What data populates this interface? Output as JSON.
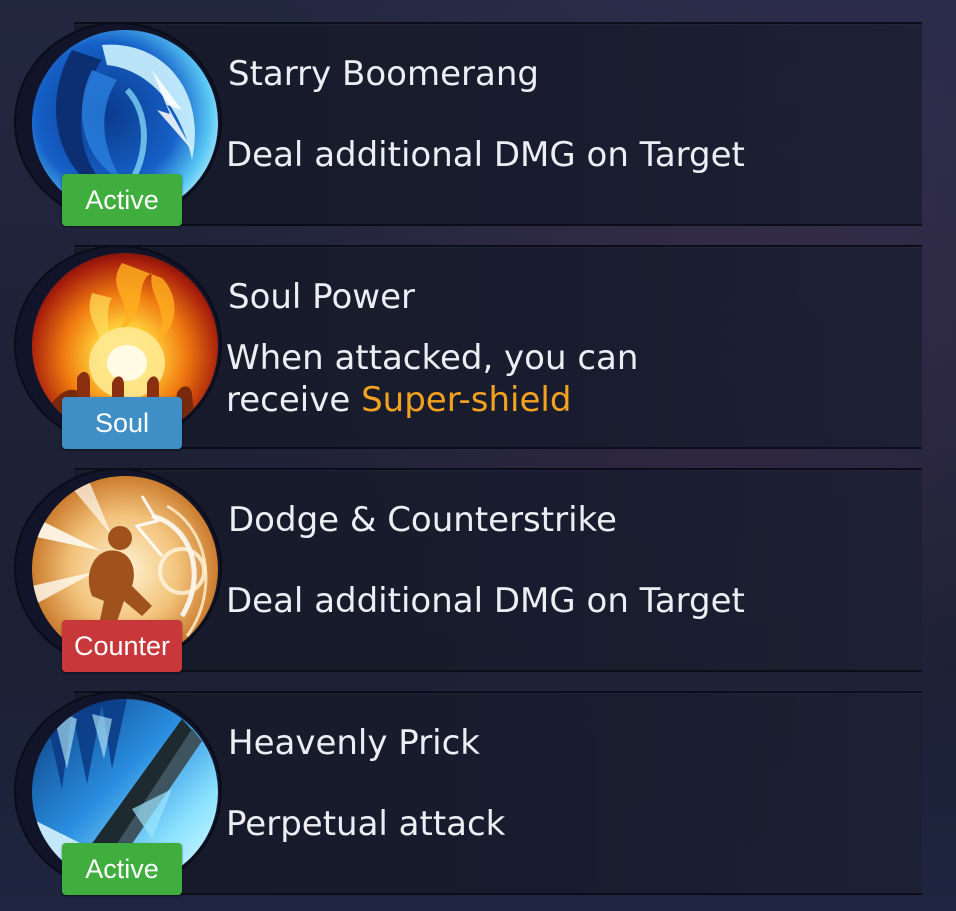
{
  "skills": [
    {
      "name": "Starry Boomerang",
      "description": "Deal additional DMG on Target",
      "badge": "Active",
      "badge_color": "#3fae3f",
      "icon": "starry-boomerang-icon"
    },
    {
      "name": "Soul Power",
      "description_line1": "When attacked, you can",
      "description_line2_prefix": "receive ",
      "description_highlight": "Super-shield",
      "badge": "Soul",
      "badge_color": "#3f8ec5",
      "icon": "soul-power-icon"
    },
    {
      "name": "Dodge & Counterstrike",
      "description": "Deal additional DMG on Target",
      "badge": "Counter",
      "badge_color": "#c8373a",
      "icon": "dodge-counterstrike-icon"
    },
    {
      "name": "Heavenly Prick",
      "description": "Perpetual attack",
      "badge": "Active",
      "badge_color": "#3fae3f",
      "icon": "heavenly-prick-icon"
    }
  ],
  "colors": {
    "highlight": "#f2a21e",
    "text": "#eceef4"
  }
}
